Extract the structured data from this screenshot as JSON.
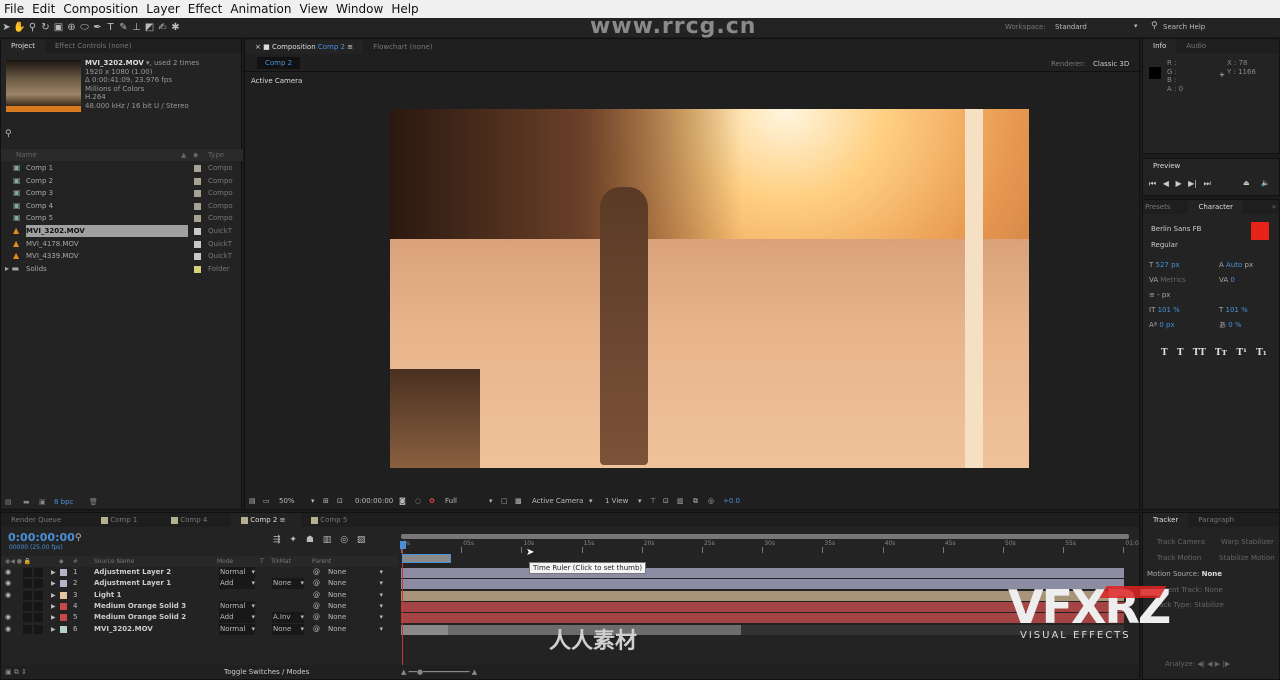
{
  "menu": [
    "File",
    "Edit",
    "Composition",
    "Layer",
    "Effect",
    "Animation",
    "View",
    "Window",
    "Help"
  ],
  "toolbar": {
    "workspace_label": "Workspace:",
    "workspace_value": "Standard",
    "search_help": "Search Help"
  },
  "watermark": {
    "site": "www.rrcg.cn",
    "logo": "VFXRZ",
    "logo_sub": "VISUAL EFFECTS",
    "center_logo": "人人素材"
  },
  "project": {
    "tab": "Project",
    "tab2": "Effect Controls (none)",
    "footage": {
      "name": "MVI_3202.MOV",
      "used": ", used 2 times",
      "res": "1920 x 1080 (1.00)",
      "duration": "Δ 0:00:41:09, 23.976 fps",
      "colors": "Millions of Colors",
      "codec": "H.264",
      "audio": "48.000 kHz / 16 bit U / Stereo"
    },
    "search_placeholder": "",
    "col_name": "Name",
    "col_type": "Type",
    "bpc": "8 bpc",
    "items": [
      {
        "name": "Comp 1",
        "type": "Compo",
        "icon": "comp-icon",
        "color": "#a8a294"
      },
      {
        "name": "Comp 2",
        "type": "Compo",
        "icon": "comp-icon",
        "color": "#a8a294"
      },
      {
        "name": "Comp 3",
        "type": "Compo",
        "icon": "comp-icon",
        "color": "#a8a294"
      },
      {
        "name": "Comp 4",
        "type": "Compo",
        "icon": "comp-icon",
        "color": "#a8a294"
      },
      {
        "name": "Comp 5",
        "type": "Compo",
        "icon": "comp-icon",
        "color": "#a8a294"
      },
      {
        "name": "MVI_3202.MOV",
        "type": "QuickT",
        "icon": "footage-icon",
        "color": "#c8c8c8",
        "selected": true
      },
      {
        "name": "MVI_4178.MOV",
        "type": "QuickT",
        "icon": "footage-icon",
        "color": "#c8c8c8"
      },
      {
        "name": "MVI_4339.MOV",
        "type": "QuickT",
        "icon": "footage-icon",
        "color": "#c8c8c8"
      },
      {
        "name": "Solids",
        "type": "Folder",
        "icon": "folder-icon",
        "color": "#d6d27a"
      }
    ]
  },
  "comp": {
    "tab_prefix": "Composition",
    "tab_name": "Comp 2",
    "tab2": "Flowchart (none)",
    "subtab": "Comp 2",
    "renderer_label": "Renderer:",
    "renderer": "Classic 3D",
    "camera_label": "Active Camera",
    "footer": {
      "zoom": "50%",
      "timecode": "0:00:00:00",
      "resolution": "Full",
      "view": "Active Camera",
      "views": "1 View",
      "exposure": "+0.0"
    }
  },
  "info": {
    "tab": "Info",
    "tab2": "Audio",
    "r": "R :",
    "g": "G :",
    "b": "B :",
    "a": "A : 0",
    "x": "X : 78",
    "y": "Y : 1166"
  },
  "preview": {
    "tab": "Preview"
  },
  "character": {
    "tab1": "Presets",
    "tab": "Character",
    "font": "Berlin Sans FB",
    "style": "Regular",
    "size": "527 px",
    "leading": "Auto",
    "leading_unit": "px",
    "kerning": "Metrics",
    "tracking": "0",
    "stroke": "- px",
    "vscale": "101 %",
    "hscale": "101 %",
    "baseline": "0 px",
    "tsume": "0 %",
    "fill_color": "#e8231a",
    "styles": [
      "T",
      "T",
      "TT",
      "Tт",
      "T¹",
      "T₁"
    ]
  },
  "tracker": {
    "tab": "Tracker",
    "tab2": "Paragraph",
    "track_camera": "Track Camera",
    "warp": "Warp Stabilizer",
    "track_motion": "Track Motion",
    "stabilize": "Stabilize Motion",
    "motion_source_label": "Motion Source:",
    "motion_source": "None",
    "current_track_label": "Current Track:",
    "current_track": "None",
    "track_type_label": "Track Type:",
    "track_type": "Stabilize",
    "analyze_label": "Analyze:"
  },
  "timeline": {
    "tabs": [
      "Render Queue",
      "Comp 1",
      "Comp 4",
      "Comp 2",
      "Comp 5"
    ],
    "active_tab": 3,
    "timecode": "0:00:00:00",
    "frames": "00000 (25.00 fps)",
    "headers": {
      "num": "#",
      "source": "Source Name",
      "mode": "Mode",
      "t": "T",
      "trkmat": "TrkMat",
      "parent": "Parent"
    },
    "toggle": "Toggle Switches / Modes",
    "ruler": [
      "0s",
      "05s",
      "10s",
      "15s",
      "20s",
      "25s",
      "30s",
      "35s",
      "40s",
      "45s",
      "50s",
      "55s",
      "01:0"
    ],
    "tooltip": "Time Ruler (Click to set thumb)",
    "layers": [
      {
        "num": "1",
        "name": "Adjustment Layer 2",
        "mode": "Normal",
        "trkmat": "",
        "parent": "None",
        "label": "#b4b4c8",
        "bar": "#8c8ca2",
        "eye": true
      },
      {
        "num": "2",
        "name": "Adjustment Layer 1",
        "mode": "Add",
        "trkmat": "None",
        "parent": "None",
        "label": "#b4b4c8",
        "bar": "#8c8ca2",
        "eye": true
      },
      {
        "num": "3",
        "name": "Light 1",
        "mode": "",
        "trkmat": "",
        "parent": "None",
        "label": "#e6c4a0",
        "bar": "#a89478",
        "eye": true
      },
      {
        "num": "4",
        "name": "Medium Orange Solid 3",
        "mode": "Normal",
        "trkmat": "",
        "parent": "None",
        "label": "#c84848",
        "bar": "#a44444",
        "eye": false
      },
      {
        "num": "5",
        "name": "Medium Orange Solid 2",
        "mode": "Add",
        "trkmat": "A.Inv",
        "parent": "None",
        "label": "#c84848",
        "bar": "#a44444",
        "eye": true
      },
      {
        "num": "6",
        "name": "MVI_3202.MOV",
        "mode": "Normal",
        "trkmat": "None",
        "parent": "None",
        "label": "#b4d2c8",
        "bar": "#6c6c6c",
        "eye": true
      }
    ]
  }
}
